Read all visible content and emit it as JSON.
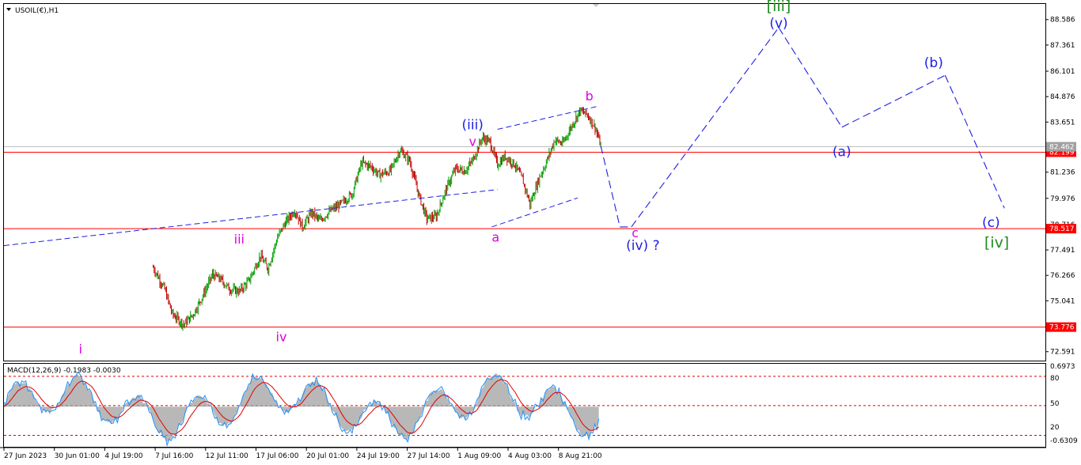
{
  "window": {
    "symbol_title": "USOIL(€),H1",
    "menu_icon": "triangle-down-icon"
  },
  "indicator": {
    "title": "MACD(12,26,9) -0.1983 -0.0030"
  },
  "chart_data": {
    "type": "candlestick",
    "price_axis": {
      "ylim": [
        72.2,
        89.3
      ],
      "ticks": [
        "88.586",
        "87.361",
        "86.101",
        "84.876",
        "83.651",
        "82.462",
        "81.236",
        "79.976",
        "78.716",
        "77.491",
        "76.266",
        "75.041",
        "73.816",
        "72.591"
      ],
      "tick_values": [
        88.586,
        87.361,
        86.101,
        84.876,
        83.651,
        82.462,
        81.236,
        79.976,
        78.716,
        77.491,
        76.266,
        75.041,
        73.816,
        72.591
      ]
    },
    "time_axis": {
      "labels": [
        "27 Jun 2023",
        "30 Jun 01:00",
        "4 Jul 19:00",
        "7 Jul 16:00",
        "12 Jul 11:00",
        "17 Jul 06:00",
        "20 Jul 01:00",
        "24 Jul 19:00",
        "27 Jul 14:00",
        "1 Aug 09:00",
        "4 Aug 03:00",
        "8 Aug 21:00"
      ]
    },
    "horizontal_levels": [
      {
        "value": 82.199,
        "label": "82.199",
        "color": "#ff0000"
      },
      {
        "value": 78.517,
        "label": "78.517",
        "color": "#ff0000"
      },
      {
        "value": 73.776,
        "label": "73.776",
        "color": "#ff0000"
      }
    ],
    "current_price": {
      "value": 82.462,
      "label": "82.462",
      "color": "#c0c0c0"
    },
    "candle_colors": {
      "up": "#00a000",
      "down": "#c00000"
    },
    "price_path": [
      [
        0,
        71.6
      ],
      [
        26,
        72.9
      ],
      [
        33,
        73.9
      ],
      [
        38,
        73.0
      ],
      [
        45,
        74.6
      ],
      [
        52,
        75.4
      ],
      [
        58,
        76.5
      ],
      [
        62,
        77.1
      ],
      [
        66,
        76.6
      ],
      [
        71,
        76.1
      ],
      [
        75,
        77.2
      ],
      [
        80,
        76.3
      ],
      [
        84,
        75.6
      ],
      [
        88,
        74.4
      ],
      [
        94,
        73.9
      ],
      [
        99,
        74.4
      ],
      [
        104,
        75.3
      ],
      [
        109,
        76.3
      ],
      [
        113,
        76.1
      ],
      [
        118,
        75.6
      ],
      [
        123,
        75.5
      ],
      [
        128,
        76.0
      ],
      [
        134,
        77.2
      ],
      [
        138,
        76.6
      ],
      [
        143,
        78.1
      ],
      [
        147,
        78.8
      ],
      [
        152,
        79.4
      ],
      [
        156,
        78.6
      ],
      [
        161,
        79.3
      ],
      [
        165,
        78.9
      ],
      [
        171,
        79.4
      ],
      [
        176,
        79.7
      ],
      [
        182,
        80.2
      ],
      [
        187,
        81.7
      ],
      [
        192,
        81.5
      ],
      [
        196,
        81.1
      ],
      [
        202,
        81.3
      ],
      [
        207,
        82.3
      ],
      [
        212,
        81.8
      ],
      [
        217,
        80.1
      ],
      [
        221,
        79.0
      ],
      [
        226,
        79.1
      ],
      [
        231,
        80.4
      ],
      [
        236,
        81.4
      ],
      [
        241,
        81.3
      ],
      [
        245,
        81.8
      ],
      [
        250,
        82.9
      ],
      [
        254,
        82.7
      ],
      [
        258,
        81.6
      ],
      [
        262,
        82.0
      ],
      [
        267,
        81.6
      ],
      [
        271,
        80.9
      ],
      [
        275,
        79.7
      ],
      [
        280,
        81.0
      ],
      [
        283,
        81.6
      ],
      [
        288,
        82.8
      ],
      [
        292,
        82.6
      ],
      [
        297,
        83.5
      ],
      [
        301,
        84.2
      ],
      [
        305,
        84.0
      ],
      [
        309,
        83.4
      ],
      [
        312,
        82.5
      ]
    ],
    "macd": {
      "ylim": [
        -0.7,
        0.75
      ],
      "ticks": [
        "0.6973",
        "80",
        "50",
        "20",
        "-0.6309"
      ],
      "levels": [
        0.55,
        0.02,
        -0.52
      ],
      "histogram_color": "#a0a0a0",
      "macd_line_color": "#1e90ff",
      "signal_line_color": "#e00000"
    },
    "annotations": {
      "trendlines": [
        {
          "from": [
            0,
            77.7
          ],
          "to": [
            258,
            80.4
          ]
        },
        {
          "from": [
            258,
            83.3
          ],
          "to": [
            310,
            84.4
          ]
        },
        {
          "from": [
            255,
            78.6
          ],
          "to": [
            300,
            80.0
          ]
        }
      ],
      "projection_path": [
        [
          312,
          82.5
        ],
        [
          322,
          78.6
        ],
        [
          328,
          78.6
        ],
        [
          405,
          88.2
        ],
        [
          438,
          83.4
        ],
        [
          492,
          85.9
        ],
        [
          523,
          79.5
        ]
      ],
      "wave_labels": [
        {
          "text": "i",
          "color": "#e000e0",
          "size": 16,
          "t": 40,
          "p": 72.5
        },
        {
          "text": "iii",
          "color": "#e000e0",
          "size": 16,
          "t": 123,
          "p": 77.8
        },
        {
          "text": "iv",
          "color": "#e000e0",
          "size": 16,
          "t": 145,
          "p": 73.1
        },
        {
          "text": "v",
          "color": "#e000e0",
          "size": 16,
          "t": 245,
          "p": 82.5
        },
        {
          "text": "(iii)",
          "color": "#1e1ee6",
          "size": 17,
          "t": 245,
          "p": 83.3
        },
        {
          "text": "a",
          "color": "#e000e0",
          "size": 16,
          "t": 257,
          "p": 77.9
        },
        {
          "text": "b",
          "color": "#e000e0",
          "size": 16,
          "t": 306,
          "p": 84.7
        },
        {
          "text": "c",
          "color": "#e000e0",
          "size": 16,
          "t": 330,
          "p": 78.1
        },
        {
          "text": "(iv) ?",
          "color": "#1e1ee6",
          "size": 17,
          "t": 334,
          "p": 77.5
        },
        {
          "text": "(v)",
          "color": "#1e1ee6",
          "size": 17,
          "t": 405,
          "p": 88.2
        },
        {
          "text": "[iii]",
          "color": "#228b22",
          "size": 19,
          "t": 405,
          "p": 89.0
        },
        {
          "text": "(a)",
          "color": "#1e1ee6",
          "size": 17,
          "t": 438,
          "p": 82.0
        },
        {
          "text": "(b)",
          "color": "#1e1ee6",
          "size": 17,
          "t": 486,
          "p": 86.3
        },
        {
          "text": "(c)",
          "color": "#1e1ee6",
          "size": 17,
          "t": 516,
          "p": 78.6
        },
        {
          "text": "[iv]",
          "color": "#228b22",
          "size": 19,
          "t": 519,
          "p": 77.6
        }
      ],
      "projection_color": "#1e1ee6"
    }
  }
}
